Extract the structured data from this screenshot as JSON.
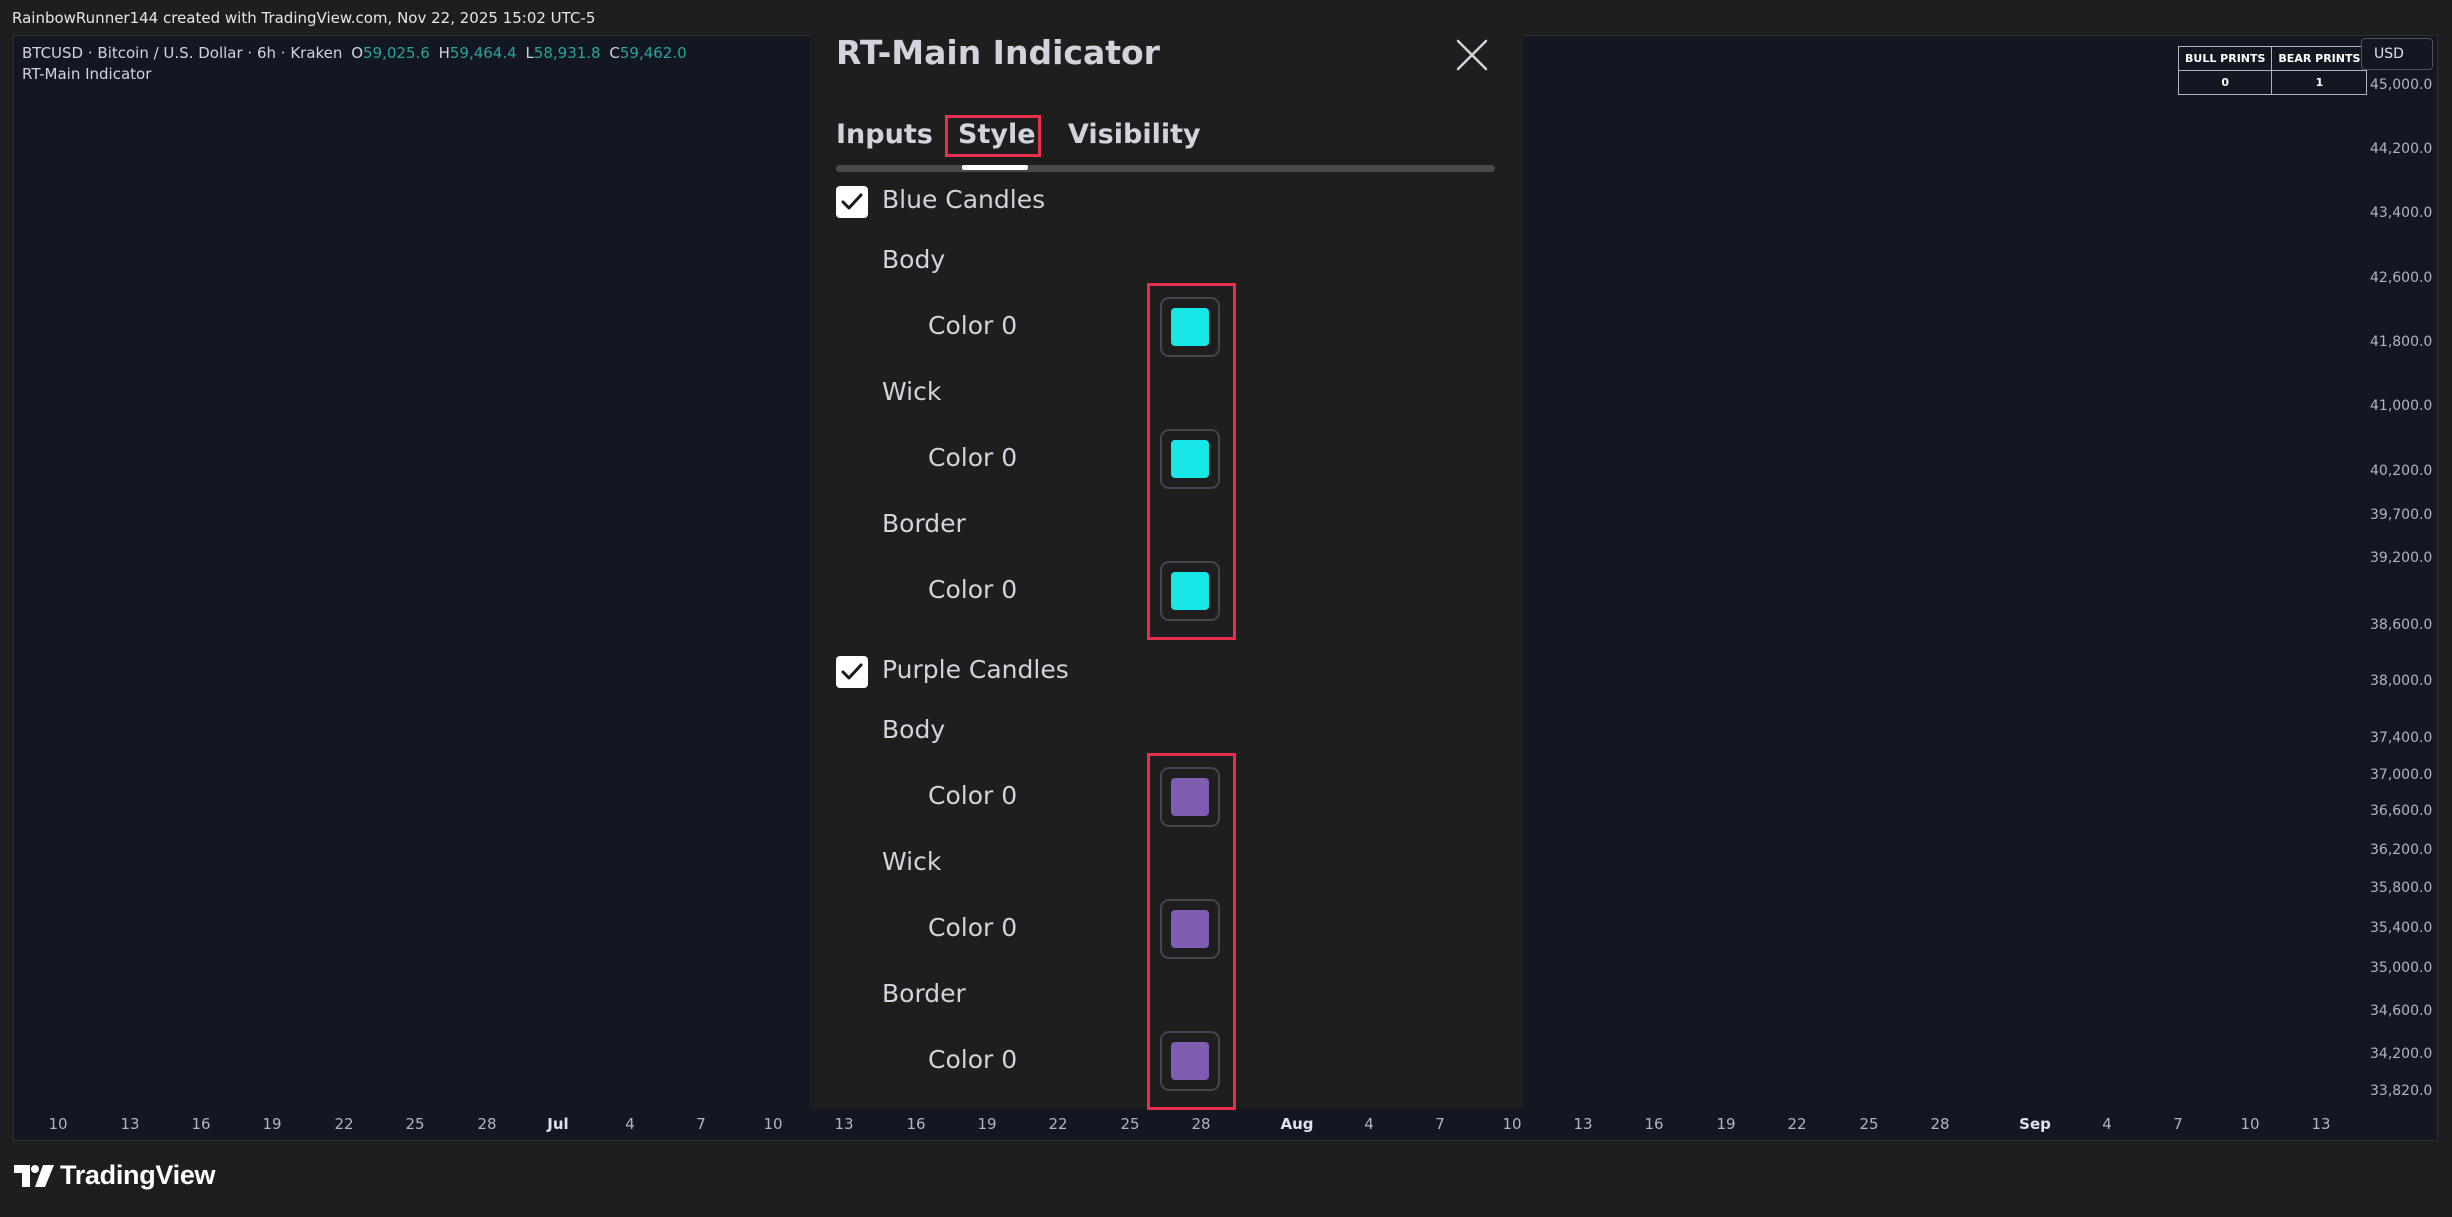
{
  "topbar": {
    "text": "RainbowRunner144 created with TradingView.com, Nov 22, 2025 15:02 UTC-5"
  },
  "legend": {
    "symbol": "BTCUSD · Bitcoin / U.S. Dollar · 6h · Kraken",
    "open_label": "O",
    "open": "59,025.6",
    "high_label": "H",
    "high": "59,464.4",
    "low_label": "L",
    "low": "58,931.8",
    "close_label": "C",
    "close": "59,462.0",
    "indicator": "RT-Main Indicator"
  },
  "prints_table": {
    "bull_header": "BULL PRINTS",
    "bear_header": "BEAR PRINTS",
    "bull_value": "0",
    "bear_value": "1"
  },
  "currency": "USD",
  "price_axis": [
    "45,000.0",
    "44,200.0",
    "43,400.0",
    "42,600.0",
    "41,800.0",
    "41,000.0",
    "40,200.0",
    "39,700.0",
    "39,200.0",
    "38,600.0",
    "38,000.0",
    "37,400.0",
    "37,000.0",
    "36,600.0",
    "36,200.0",
    "35,800.0",
    "35,400.0",
    "35,000.0",
    "34,600.0",
    "34,200.0",
    "33,820.0"
  ],
  "time_axis": [
    "10",
    "13",
    "16",
    "19",
    "22",
    "25",
    "28",
    "Jul",
    "4",
    "7",
    "10",
    "13",
    "16",
    "19",
    "22",
    "25",
    "28",
    "Aug",
    "4",
    "7",
    "10",
    "13",
    "16",
    "19",
    "22",
    "25",
    "28",
    "Sep",
    "4",
    "7",
    "10",
    "13"
  ],
  "footer": {
    "brand": "TradingView"
  },
  "dialog": {
    "title": "RT-Main Indicator",
    "tabs": [
      {
        "label": "Inputs"
      },
      {
        "label": "Style",
        "active": true
      },
      {
        "label": "Visibility"
      }
    ],
    "groups": [
      {
        "label": "Blue Candles",
        "checked": true,
        "rows": [
          {
            "label": "Body",
            "color_label": "Color 0",
            "color": "#18e7e8"
          },
          {
            "label": "Wick",
            "color_label": "Color 0",
            "color": "#18e7e8"
          },
          {
            "label": "Border",
            "color_label": "Color 0",
            "color": "#18e7e8"
          }
        ]
      },
      {
        "label": "Purple Candles",
        "checked": true,
        "rows": [
          {
            "label": "Body",
            "color_label": "Color 0",
            "color": "#7f5db1"
          },
          {
            "label": "Wick",
            "color_label": "Color 0",
            "color": "#7f5db1"
          },
          {
            "label": "Border",
            "color_label": "Color 0",
            "color": "#7f5db1"
          }
        ]
      }
    ]
  },
  "colors": {
    "highlight": "#e62e4d",
    "chart_bg": "#131722",
    "panel_bg": "#1e1e1e",
    "legend_value": "#26a69a"
  },
  "icons": {
    "close": "close-icon",
    "check": "checkmark-icon",
    "logo": "tradingview-logo-icon"
  }
}
